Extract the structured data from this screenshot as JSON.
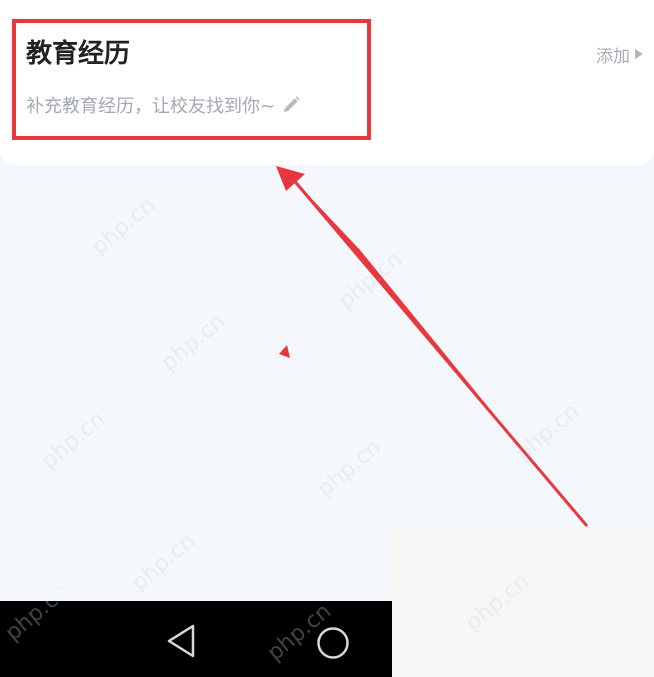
{
  "education": {
    "title": "教育经历",
    "hint": "补充教育经历，让校友找到你~",
    "add_label": "添加"
  },
  "icons": {
    "edit": "pencil-icon",
    "add": "play-triangle-icon",
    "back": "triangle-back-icon",
    "home": "circle-home-icon"
  },
  "watermark_text": "php.cn",
  "colors": {
    "highlight": "#e8373f",
    "title": "#222222",
    "hint": "#a3a9b4",
    "background": "#f4f7fb",
    "nav_bar": "#000000"
  }
}
